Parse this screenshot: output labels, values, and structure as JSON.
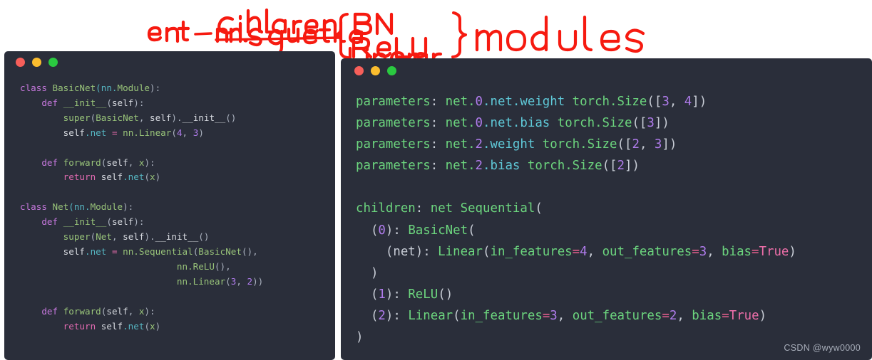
{
  "annotation": {
    "type": "handwritten-red-ink",
    "color": "#f61a10",
    "texts": {
      "children": "children",
      "net_expr": "net — nn.Sequetial",
      "brace_items": [
        "BN",
        "ReLU",
        "Linear"
      ],
      "modules": "modules"
    }
  },
  "left_panel": {
    "window_dots": [
      "red",
      "yellow",
      "green"
    ],
    "lines": [
      [
        {
          "t": "class ",
          "c": "t-kw"
        },
        {
          "t": "BasicNet",
          "c": "t-fn"
        },
        {
          "t": "(nn.",
          "c": "t-attr"
        },
        {
          "t": "Module",
          "c": "t-fn"
        },
        {
          "t": "):",
          "c": "t-punc"
        }
      ],
      [
        {
          "t": "    ",
          "c": "t-var"
        },
        {
          "t": "def ",
          "c": "t-kw"
        },
        {
          "t": "__init__",
          "c": "t-fn"
        },
        {
          "t": "(",
          "c": "t-punc"
        },
        {
          "t": "self",
          "c": "t-wh"
        },
        {
          "t": "):",
          "c": "t-punc"
        }
      ],
      [
        {
          "t": "        ",
          "c": "t-var"
        },
        {
          "t": "super",
          "c": "t-fn"
        },
        {
          "t": "(",
          "c": "t-punc"
        },
        {
          "t": "BasicNet",
          "c": "t-fn"
        },
        {
          "t": ", ",
          "c": "t-punc"
        },
        {
          "t": "self",
          "c": "t-wh"
        },
        {
          "t": ").",
          "c": "t-punc"
        },
        {
          "t": "__init__",
          "c": "t-wh"
        },
        {
          "t": "()",
          "c": "t-punc"
        }
      ],
      [
        {
          "t": "        ",
          "c": "t-var"
        },
        {
          "t": "self",
          "c": "t-wh"
        },
        {
          "t": ".net",
          "c": "t-attr"
        },
        {
          "t": " = ",
          "c": "t-op"
        },
        {
          "t": "nn.Linear",
          "c": "t-fn"
        },
        {
          "t": "(",
          "c": "t-punc"
        },
        {
          "t": "4",
          "c": "t-num"
        },
        {
          "t": ", ",
          "c": "t-punc"
        },
        {
          "t": "3",
          "c": "t-num"
        },
        {
          "t": ")",
          "c": "t-punc"
        }
      ],
      [],
      [
        {
          "t": "    ",
          "c": "t-var"
        },
        {
          "t": "def ",
          "c": "t-kw"
        },
        {
          "t": "forward",
          "c": "t-fn"
        },
        {
          "t": "(",
          "c": "t-punc"
        },
        {
          "t": "self",
          "c": "t-wh"
        },
        {
          "t": ", ",
          "c": "t-punc"
        },
        {
          "t": "x",
          "c": "t-fn"
        },
        {
          "t": "):",
          "c": "t-punc"
        }
      ],
      [
        {
          "t": "        ",
          "c": "t-var"
        },
        {
          "t": "return ",
          "c": "t-kw2"
        },
        {
          "t": "self",
          "c": "t-wh"
        },
        {
          "t": ".net",
          "c": "t-attr"
        },
        {
          "t": "(",
          "c": "t-punc"
        },
        {
          "t": "x",
          "c": "t-fn"
        },
        {
          "t": ")",
          "c": "t-punc"
        }
      ],
      [],
      [
        {
          "t": "class ",
          "c": "t-kw"
        },
        {
          "t": "Net",
          "c": "t-fn"
        },
        {
          "t": "(nn.",
          "c": "t-attr"
        },
        {
          "t": "Module",
          "c": "t-fn"
        },
        {
          "t": "):",
          "c": "t-punc"
        }
      ],
      [
        {
          "t": "    ",
          "c": "t-var"
        },
        {
          "t": "def ",
          "c": "t-kw"
        },
        {
          "t": "__init__",
          "c": "t-fn"
        },
        {
          "t": "(",
          "c": "t-punc"
        },
        {
          "t": "self",
          "c": "t-wh"
        },
        {
          "t": "):",
          "c": "t-punc"
        }
      ],
      [
        {
          "t": "        ",
          "c": "t-var"
        },
        {
          "t": "super",
          "c": "t-fn"
        },
        {
          "t": "(",
          "c": "t-punc"
        },
        {
          "t": "Net",
          "c": "t-fn"
        },
        {
          "t": ", ",
          "c": "t-punc"
        },
        {
          "t": "self",
          "c": "t-wh"
        },
        {
          "t": ").",
          "c": "t-punc"
        },
        {
          "t": "__init__",
          "c": "t-wh"
        },
        {
          "t": "()",
          "c": "t-punc"
        }
      ],
      [
        {
          "t": "        ",
          "c": "t-var"
        },
        {
          "t": "self",
          "c": "t-wh"
        },
        {
          "t": ".net",
          "c": "t-attr"
        },
        {
          "t": " = ",
          "c": "t-op"
        },
        {
          "t": "nn.Sequential",
          "c": "t-fn"
        },
        {
          "t": "(",
          "c": "t-punc"
        },
        {
          "t": "BasicNet",
          "c": "t-fn"
        },
        {
          "t": "(),",
          "c": "t-punc"
        }
      ],
      [
        {
          "t": "                             ",
          "c": "t-var"
        },
        {
          "t": "nn.ReLU",
          "c": "t-fn"
        },
        {
          "t": "(),",
          "c": "t-punc"
        }
      ],
      [
        {
          "t": "                             ",
          "c": "t-var"
        },
        {
          "t": "nn.Linear",
          "c": "t-fn"
        },
        {
          "t": "(",
          "c": "t-punc"
        },
        {
          "t": "3",
          "c": "t-num"
        },
        {
          "t": ", ",
          "c": "t-punc"
        },
        {
          "t": "2",
          "c": "t-num"
        },
        {
          "t": "))",
          "c": "t-punc"
        }
      ],
      [],
      [
        {
          "t": "    ",
          "c": "t-var"
        },
        {
          "t": "def ",
          "c": "t-kw"
        },
        {
          "t": "forward",
          "c": "t-fn"
        },
        {
          "t": "(",
          "c": "t-punc"
        },
        {
          "t": "self",
          "c": "t-wh"
        },
        {
          "t": ", ",
          "c": "t-punc"
        },
        {
          "t": "x",
          "c": "t-fn"
        },
        {
          "t": "):",
          "c": "t-punc"
        }
      ],
      [
        {
          "t": "        ",
          "c": "t-var"
        },
        {
          "t": "return ",
          "c": "t-kw2"
        },
        {
          "t": "self",
          "c": "t-wh"
        },
        {
          "t": ".net",
          "c": "t-attr"
        },
        {
          "t": "(",
          "c": "t-punc"
        },
        {
          "t": "x",
          "c": "t-fn"
        },
        {
          "t": ")",
          "c": "t-punc"
        }
      ]
    ]
  },
  "right_panel": {
    "window_dots": [
      "red",
      "yellow",
      "green"
    ],
    "lines": [
      [
        {
          "t": "parameters",
          "c": "o-green"
        },
        {
          "t": ": ",
          "c": "o-grey"
        },
        {
          "t": "net.",
          "c": "o-green"
        },
        {
          "t": "0",
          "c": "o-num"
        },
        {
          "t": ".net.weight ",
          "c": "o-cyan"
        },
        {
          "t": "torch.Size",
          "c": "o-green"
        },
        {
          "t": "([",
          "c": "o-grey"
        },
        {
          "t": "3",
          "c": "o-num"
        },
        {
          "t": ", ",
          "c": "o-grey"
        },
        {
          "t": "4",
          "c": "o-num"
        },
        {
          "t": "])",
          "c": "o-grey"
        }
      ],
      [
        {
          "t": "parameters",
          "c": "o-green"
        },
        {
          "t": ": ",
          "c": "o-grey"
        },
        {
          "t": "net.",
          "c": "o-green"
        },
        {
          "t": "0",
          "c": "o-num"
        },
        {
          "t": ".net.bias ",
          "c": "o-cyan"
        },
        {
          "t": "torch.Size",
          "c": "o-green"
        },
        {
          "t": "([",
          "c": "o-grey"
        },
        {
          "t": "3",
          "c": "o-num"
        },
        {
          "t": "])",
          "c": "o-grey"
        }
      ],
      [
        {
          "t": "parameters",
          "c": "o-green"
        },
        {
          "t": ": ",
          "c": "o-grey"
        },
        {
          "t": "net.",
          "c": "o-green"
        },
        {
          "t": "2",
          "c": "o-num"
        },
        {
          "t": ".weight ",
          "c": "o-cyan"
        },
        {
          "t": "torch.Size",
          "c": "o-green"
        },
        {
          "t": "([",
          "c": "o-grey"
        },
        {
          "t": "2",
          "c": "o-num"
        },
        {
          "t": ", ",
          "c": "o-grey"
        },
        {
          "t": "3",
          "c": "o-num"
        },
        {
          "t": "])",
          "c": "o-grey"
        }
      ],
      [
        {
          "t": "parameters",
          "c": "o-green"
        },
        {
          "t": ": ",
          "c": "o-grey"
        },
        {
          "t": "net.",
          "c": "o-green"
        },
        {
          "t": "2",
          "c": "o-num"
        },
        {
          "t": ".bias ",
          "c": "o-cyan"
        },
        {
          "t": "torch.Size",
          "c": "o-green"
        },
        {
          "t": "([",
          "c": "o-grey"
        },
        {
          "t": "2",
          "c": "o-num"
        },
        {
          "t": "])",
          "c": "o-grey"
        }
      ],
      [],
      [
        {
          "t": "children",
          "c": "o-green"
        },
        {
          "t": ": ",
          "c": "o-grey"
        },
        {
          "t": "net Sequential",
          "c": "o-green"
        },
        {
          "t": "(",
          "c": "o-grey"
        }
      ],
      [
        {
          "t": "  (",
          "c": "o-grey"
        },
        {
          "t": "0",
          "c": "o-num"
        },
        {
          "t": "): ",
          "c": "o-grey"
        },
        {
          "t": "BasicNet",
          "c": "o-green"
        },
        {
          "t": "(",
          "c": "o-grey"
        }
      ],
      [
        {
          "t": "    (net): ",
          "c": "o-grey"
        },
        {
          "t": "Linear",
          "c": "o-green"
        },
        {
          "t": "(",
          "c": "o-grey"
        },
        {
          "t": "in_features",
          "c": "o-green"
        },
        {
          "t": "=",
          "c": "o-eq"
        },
        {
          "t": "4",
          "c": "o-num"
        },
        {
          "t": ", ",
          "c": "o-grey"
        },
        {
          "t": "out_features",
          "c": "o-green"
        },
        {
          "t": "=",
          "c": "o-eq"
        },
        {
          "t": "3",
          "c": "o-num"
        },
        {
          "t": ", ",
          "c": "o-grey"
        },
        {
          "t": "bias",
          "c": "o-green"
        },
        {
          "t": "=",
          "c": "o-eq"
        },
        {
          "t": "True",
          "c": "o-bool"
        },
        {
          "t": ")",
          "c": "o-grey"
        }
      ],
      [
        {
          "t": "  )",
          "c": "o-grey"
        }
      ],
      [
        {
          "t": "  (",
          "c": "o-grey"
        },
        {
          "t": "1",
          "c": "o-num"
        },
        {
          "t": "): ",
          "c": "o-grey"
        },
        {
          "t": "ReLU",
          "c": "o-green"
        },
        {
          "t": "()",
          "c": "o-grey"
        }
      ],
      [
        {
          "t": "  (",
          "c": "o-grey"
        },
        {
          "t": "2",
          "c": "o-num"
        },
        {
          "t": "): ",
          "c": "o-grey"
        },
        {
          "t": "Linear",
          "c": "o-green"
        },
        {
          "t": "(",
          "c": "o-grey"
        },
        {
          "t": "in_features",
          "c": "o-green"
        },
        {
          "t": "=",
          "c": "o-eq"
        },
        {
          "t": "3",
          "c": "o-num"
        },
        {
          "t": ", ",
          "c": "o-grey"
        },
        {
          "t": "out_features",
          "c": "o-green"
        },
        {
          "t": "=",
          "c": "o-eq"
        },
        {
          "t": "2",
          "c": "o-num"
        },
        {
          "t": ", ",
          "c": "o-grey"
        },
        {
          "t": "bias",
          "c": "o-green"
        },
        {
          "t": "=",
          "c": "o-eq"
        },
        {
          "t": "True",
          "c": "o-bool"
        },
        {
          "t": ")",
          "c": "o-grey"
        }
      ],
      [
        {
          "t": ")",
          "c": "o-grey"
        }
      ]
    ]
  },
  "watermark": {
    "text": "CSDN @wyw0000"
  },
  "colors": {
    "panel_bg": "#2a2e3a",
    "page_bg": "#ffffff",
    "ink": "#f61a10",
    "dot_red": "#f75f5a",
    "dot_yellow": "#fbbd2e",
    "dot_green": "#2ac940"
  }
}
